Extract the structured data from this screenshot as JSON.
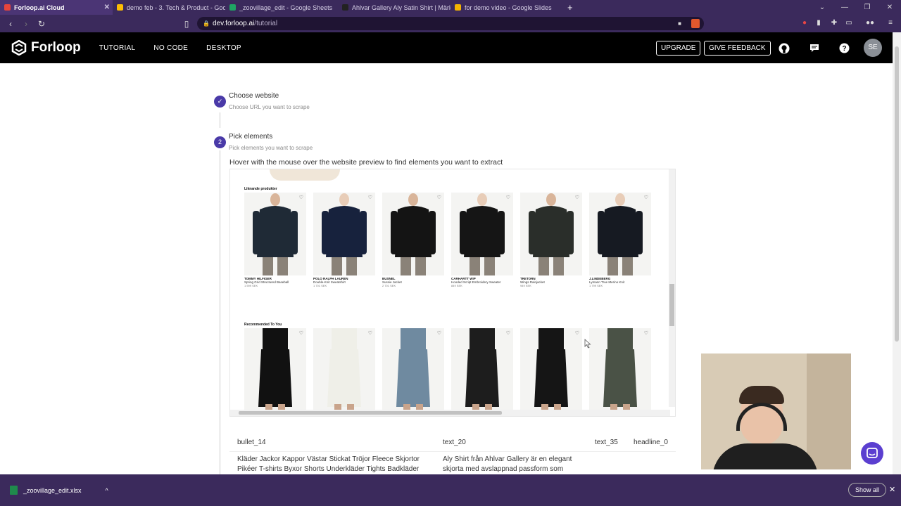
{
  "browser": {
    "tabs": [
      {
        "title": "Forloop.ai Cloud",
        "active": true,
        "color": "#e8453c"
      },
      {
        "title": "demo feb - 3. Tech & Product - Googl",
        "active": false,
        "color": "#fbbc04"
      },
      {
        "title": "_zoovillage_edit - Google Sheets",
        "active": false,
        "color": "#1fa463"
      },
      {
        "title": "Ahlvar Gallery Aly Satin Shirt | Märkes",
        "active": false,
        "color": "#222222"
      },
      {
        "title": "for demo video - Google Slides",
        "active": false,
        "color": "#f4b400"
      }
    ],
    "new_tab": "+",
    "url_host": "dev.forloop.ai",
    "url_path": "/tutorial"
  },
  "app": {
    "logo": "Forloop",
    "nav": [
      "TUTORIAL",
      "NO CODE",
      "DESKTOP"
    ],
    "upgrade": "UPGRADE",
    "feedback": "GIVE FEEDBACK",
    "avatar": "SE"
  },
  "steps": [
    {
      "title": "Choose website",
      "sub": "Choose URL you want to scrape",
      "done": true
    },
    {
      "number": "2",
      "title": "Pick elements",
      "sub": "Pick elements you want to scrape",
      "done": false
    }
  ],
  "instruction": "Hover with the mouse over the website preview to find elements you want to extract",
  "preview": {
    "section1": "Liknande produkter",
    "section2": "Recommended To You",
    "row1": [
      {
        "brand": "TOMMY HILFIGER",
        "name": "Spring Grid Structured Baseball",
        "price": "1 599 SEK",
        "color": "#1f2a36"
      },
      {
        "brand": "POLO RALPH LAUREN",
        "name": "Double-Knit Sweatshirt",
        "price": "1 701 SEK",
        "color": "#17223d"
      },
      {
        "brand": "BUSNEL",
        "name": "Sussie Jacket",
        "price": "2 701 SEK",
        "color": "#141414"
      },
      {
        "brand": "CARHARTT WIP",
        "name": "Hooded Script Embroidery Sweater",
        "price": "849 SEK",
        "color": "#151515"
      },
      {
        "brand": "TRETORN",
        "name": "Wings Rainjacket",
        "price": "949 SEK",
        "color": "#2a2e2a"
      },
      {
        "brand": "J.LINDEBERG",
        "name": "Lymann True Merino Knit",
        "price": "1 799 SEK",
        "color": "#161a22"
      }
    ],
    "row2": [
      {
        "color": "#111111"
      },
      {
        "color": "#efefe8"
      },
      {
        "color": "#6f8aa0"
      },
      {
        "color": "#1d1d1d"
      },
      {
        "color": "#151515"
      },
      {
        "color": "#4a5246"
      }
    ]
  },
  "table": {
    "columns": [
      "bullet_14",
      "text_20",
      "text_35",
      "headline_0"
    ],
    "bullet": "Kläder Jackor Kappor Västar Stickat Tröjor Fleece Skjortor Pikéer T-shirts Byxor Shorts Underkläder Tights Badkläder",
    "text": "Aly Shirt från Ahlvar Gallery är en elegant skjorta med avslappnad passform som"
  },
  "downloads": {
    "file": "_zoovillage_edit.xlsx",
    "show_all": "Show all"
  }
}
